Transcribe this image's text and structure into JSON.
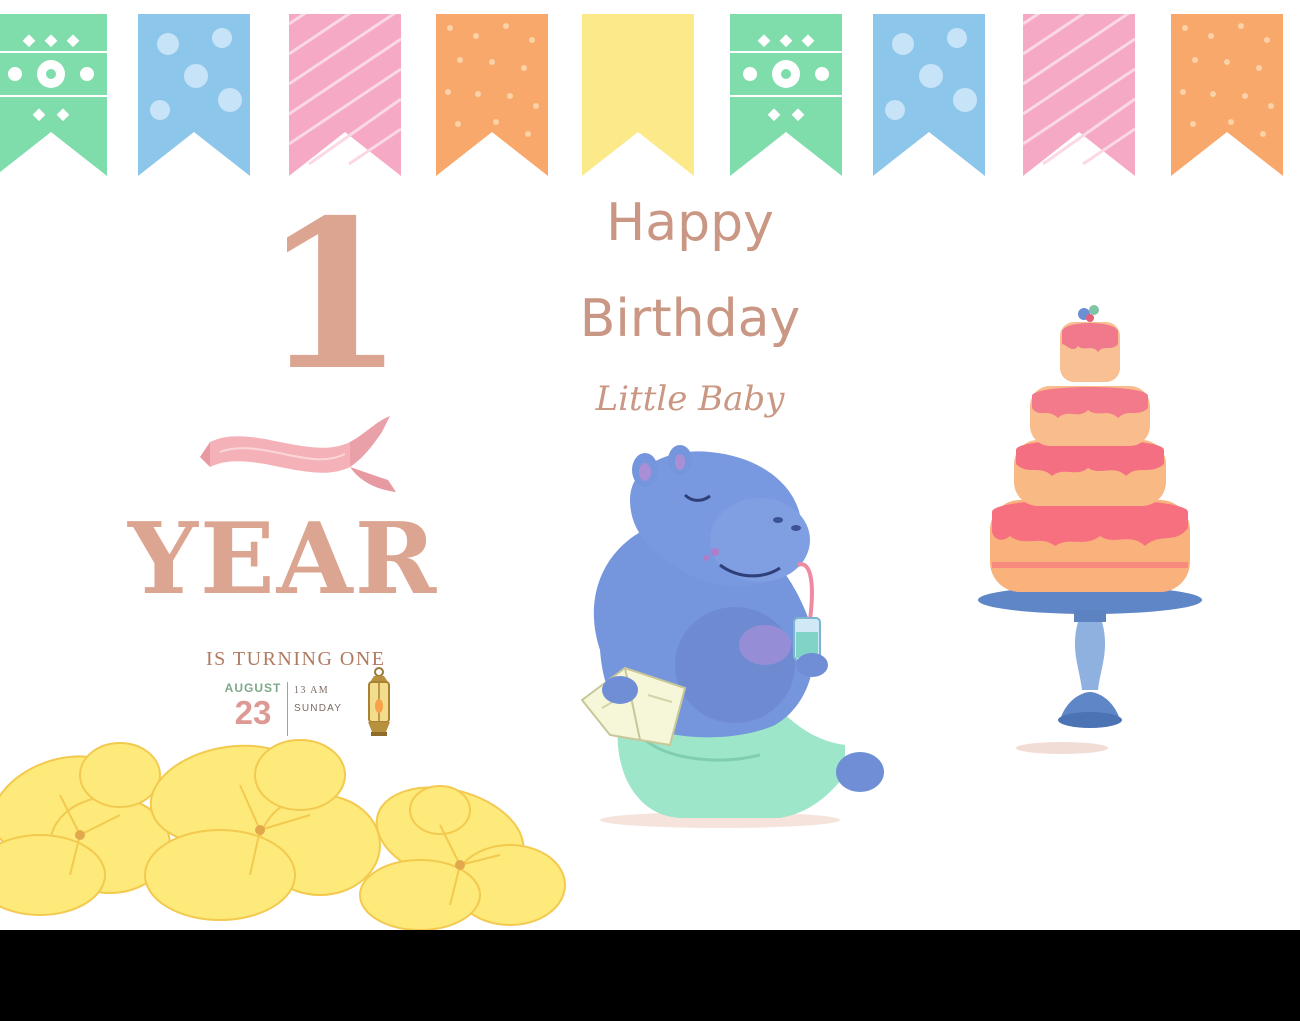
{
  "heading": {
    "line1": "Happy",
    "line2": "Birthday",
    "line3": "Little Baby"
  },
  "age": {
    "number": "1",
    "unit": "YEAR",
    "caption": "IS TURNING ONE"
  },
  "date": {
    "month": "AUGUST",
    "day": "23",
    "time": "13 AM",
    "weekday": "SUNDAY"
  },
  "colors": {
    "title": "#c99783",
    "age": "#dba592",
    "month": "#7ea989",
    "day": "#dd9a94",
    "flag_green": "#7fdcab",
    "flag_blue": "#8cc6ea",
    "flag_pink": "#f5a9c4",
    "flag_orange": "#f9a86c",
    "flag_yellow": "#fbe98a"
  },
  "illustrations": {
    "bunting_flags": [
      "green",
      "blue",
      "pink",
      "orange",
      "yellow",
      "green",
      "blue",
      "pink",
      "orange"
    ],
    "items": [
      "bunting-icon",
      "ribbon-icon",
      "lantern-icon",
      "hippo-icon",
      "cake-icon",
      "flower-icon"
    ]
  }
}
